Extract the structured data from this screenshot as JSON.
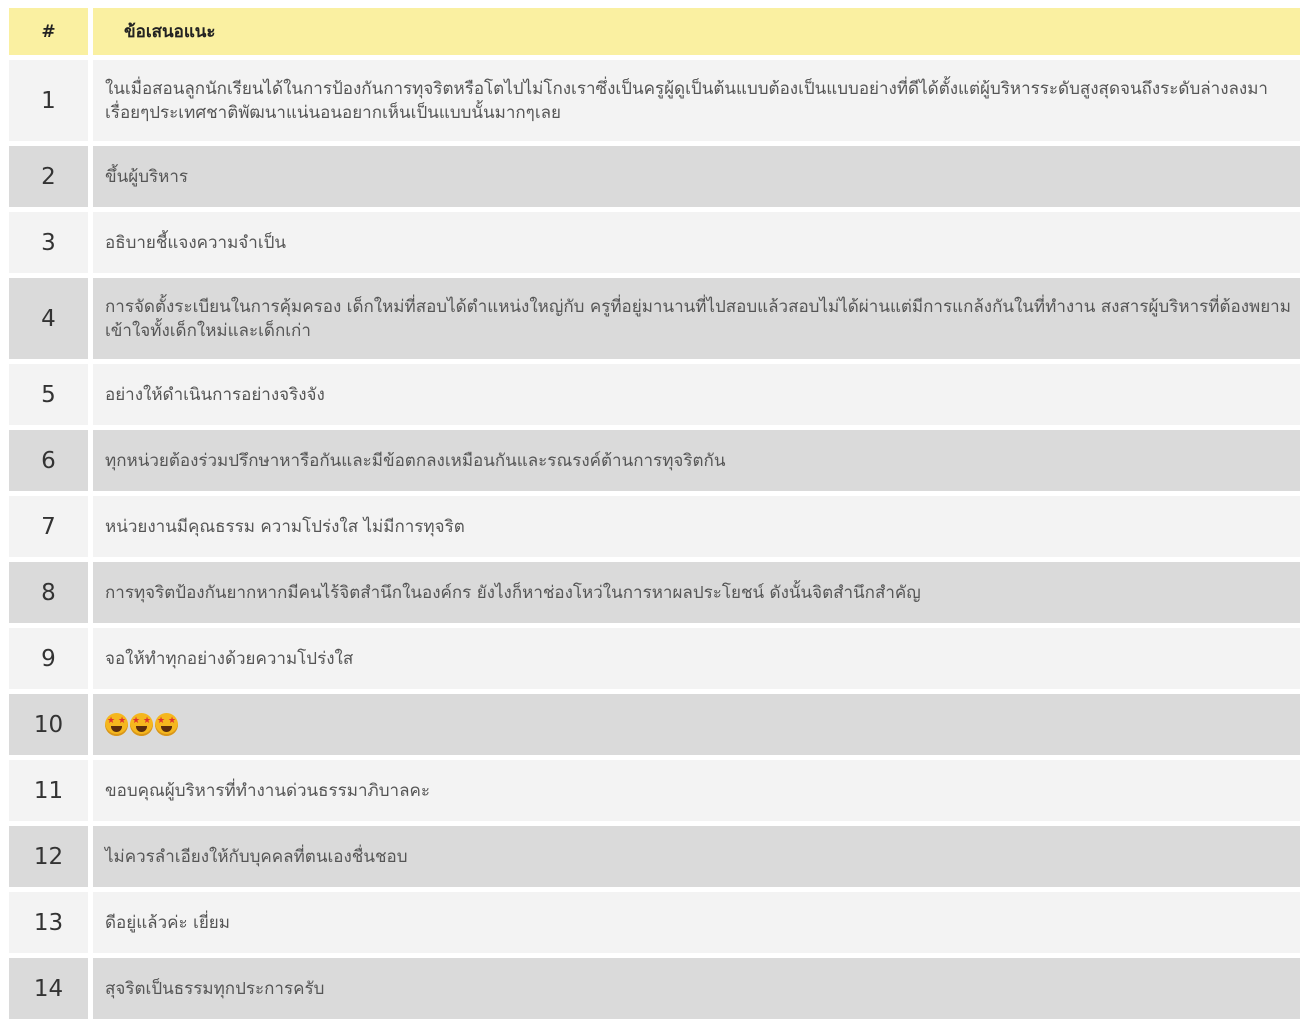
{
  "header": {
    "num_label": "#",
    "text_label": "ข้อเสนอแนะ"
  },
  "rows": [
    {
      "num": "1",
      "text": "ในเมื่อสอนลูกนักเรียนได้ในการป้องกันการทุจริตหรือโตไปไม่โกงเราซึ่งเป็นครูผู้ดูเป็นต้นแบบต้องเป็นแบบอย่างที่ดีได้ตั้งแต่ผู้บริหารระดับสูงสุดจนถึงระดับล่างลงมาเรื่อยๆประเทศชาติพัฒนาแน่นอนอยากเห็นเป็นแบบนั้นมากๆเลย"
    },
    {
      "num": "2",
      "text": "ขึ้นผู้บริหาร"
    },
    {
      "num": "3",
      "text": "อธิบายชี้แจงความจำเป็น"
    },
    {
      "num": "4",
      "text": "การจัดตั้งระเบียนในการคุ้มครอง เด็กใหม่ที่สอบได้ตำแหน่งใหญ่กับ ครูที่อยู่มานานที่ไปสอบแล้วสอบไม่ได้ผ่านแต่มีการแกล้งกันในที่ทำงาน สงสารผู้บริหารที่ต้องพยามเข้าใจทั้งเด็กใหม่และเด็กเก่า"
    },
    {
      "num": "5",
      "text": "อย่างให้ดำเนินการอย่างจริงจัง"
    },
    {
      "num": "6",
      "text": "ทุกหน่วยต้องร่วมปรึกษาหารือกันและมีข้อตกลงเหมือนกันและรณรงค์ต้านการทุจริตกัน"
    },
    {
      "num": "7",
      "text": "หน่วยงานมีคุณธรรม ความโปร่งใส ไม่มีการทุจริต"
    },
    {
      "num": "8",
      "text": "การทุจริตป้องกันยากหากมีคนไร้จิตสำนึกในองค์กร ยังไงก็หาช่องโหว่ในการหาผลประโยชน์ ดังนั้นจิตสำนึกสำคัญ"
    },
    {
      "num": "9",
      "text": "จอให้ทำทุกอย่างด้วยความโปร่งใส"
    },
    {
      "num": "10",
      "text": "",
      "emoji": "star-struck-face-icon"
    },
    {
      "num": "11",
      "text": "ขอบคุณผู้บริหารที่ทำงานด่วนธรรมาภิบาลคะ"
    },
    {
      "num": "12",
      "text": "ไม่ควรลำเอียงให้กับบุคคลที่ตนเองชื่นชอบ"
    },
    {
      "num": "13",
      "text": "ดีอยู่แล้วค่ะ เยี่ยม"
    },
    {
      "num": "14",
      "text": "สุจริตเป็นธรรมทุกประการครับ"
    }
  ],
  "colors": {
    "header_bg": "#faf0a1",
    "row_light": "#f3f3f3",
    "row_dark": "#dadada"
  }
}
